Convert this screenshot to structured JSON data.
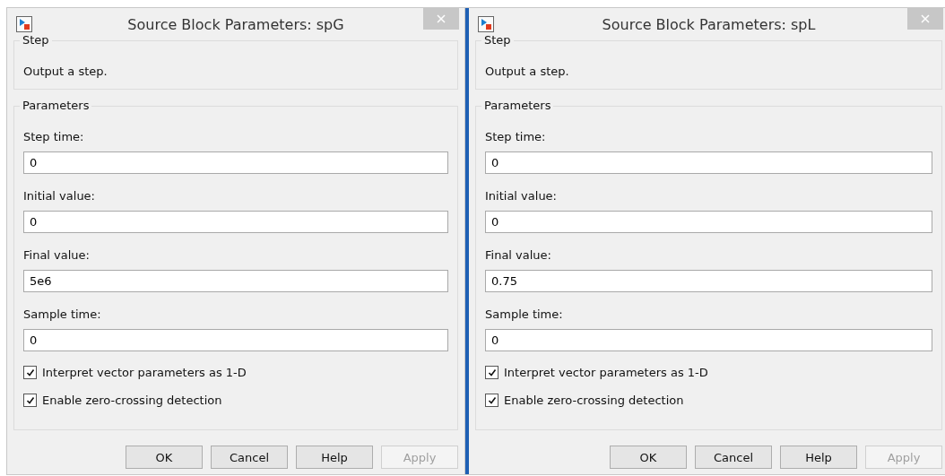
{
  "dialogs": [
    {
      "title": "Source Block Parameters: spG",
      "active": false,
      "description_group": {
        "title": "Step",
        "text": "Output a step."
      },
      "parameters_group": {
        "title": "Parameters",
        "fields": [
          {
            "label": "Step time:",
            "value": "0"
          },
          {
            "label": "Initial value:",
            "value": "0"
          },
          {
            "label": "Final value:",
            "value": "5e6"
          },
          {
            "label": "Sample time:",
            "value": "0"
          }
        ],
        "checkboxes": [
          {
            "label": "Interpret vector parameters as 1-D",
            "checked": true
          },
          {
            "label": "Enable zero-crossing detection",
            "checked": true
          }
        ]
      },
      "buttons": [
        {
          "label": "OK",
          "disabled": false
        },
        {
          "label": "Cancel",
          "disabled": false
        },
        {
          "label": "Help",
          "disabled": false
        },
        {
          "label": "Apply",
          "disabled": true
        }
      ]
    },
    {
      "title": "Source Block Parameters: spL",
      "active": true,
      "description_group": {
        "title": "Step",
        "text": "Output a step."
      },
      "parameters_group": {
        "title": "Parameters",
        "fields": [
          {
            "label": "Step time:",
            "value": "0"
          },
          {
            "label": "Initial value:",
            "value": "0"
          },
          {
            "label": "Final value:",
            "value": "0.75"
          },
          {
            "label": "Sample time:",
            "value": "0"
          }
        ],
        "checkboxes": [
          {
            "label": "Interpret vector parameters as 1-D",
            "checked": true
          },
          {
            "label": "Enable zero-crossing detection",
            "checked": true
          }
        ]
      },
      "buttons": [
        {
          "label": "OK",
          "disabled": false
        },
        {
          "label": "Cancel",
          "disabled": false
        },
        {
          "label": "Help",
          "disabled": false
        },
        {
          "label": "Apply",
          "disabled": true
        }
      ]
    }
  ]
}
